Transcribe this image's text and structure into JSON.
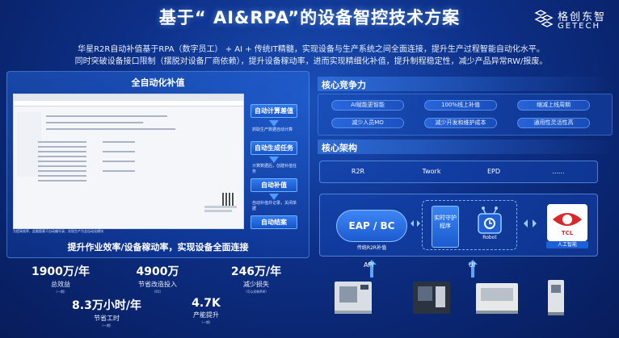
{
  "title": "基于“ AI&RPA”的设备智控技术方案",
  "logo": {
    "cn": "格创东智",
    "en": "GETECH",
    "icon": "getech-logo-icon",
    "accent": "#ffffff"
  },
  "intro": {
    "line1": "华星R2R自动补值基于RPA（数字员工） + AI + 传统IT精髓，实现设备与生产系统之间全面连接，提升生产过程智能自动化水平。",
    "line2": "同时突破设备接口限制（摆脱对设备厂商依赖），提升设备稼动率，进而实现精细化补值，提升制程稳定性，减少产品异常RW/报废。"
  },
  "left_panel": {
    "title": "全自动化补值",
    "screen_caption": "为提高效率，此截图基于自动编号录，实现生产为全自动化模块",
    "steps": [
      {
        "label": "自动计算差值",
        "note": ""
      },
      {
        "label": "自动生成任务",
        "note": "抓取生产数据自动计算"
      },
      {
        "label": "自动补值",
        "note": "计算数据后，创建补值任务"
      },
      {
        "label": "自动结案",
        "note": "自动补值并记录，关闭单据"
      }
    ],
    "bottom_title": "提升作业效率/设备稼动率，实现设备全面连接",
    "stats": [
      {
        "value": "1900万/年",
        "label": "总效益",
        "note": "（一期）"
      },
      {
        "value": "4900万",
        "label": "节省改造投入",
        "note": "（R2）"
      },
      {
        "value": "246万/年",
        "label": "减少损失",
        "note": "（可以抑制RW）"
      },
      {
        "value": "8.3万小时/年",
        "label": "节省工时",
        "note": "（一期）"
      },
      {
        "value": "4.7K",
        "label": "产能提升",
        "note": "（一期）"
      }
    ]
  },
  "core_competence": {
    "title": "核心竞争力",
    "items": [
      "AI赋能更智能",
      "100%线上补值",
      "缩减上线周期",
      "减少人员MO",
      "减少开发和维护成本",
      "通用性灵活性高"
    ]
  },
  "core_architecture": {
    "title": "核心架构",
    "systems": [
      "R2R",
      "Twork",
      "EPD",
      "......"
    ],
    "eap_label": "EAP / BC",
    "eap_caption": "传统R2R补值",
    "service_label": "实时守护程序",
    "robot_label": "Robot",
    "ai_label": "人工智能",
    "tcl_text": "TCL",
    "api_label": "API",
    "ui_label": "UI"
  },
  "colors": {
    "bg_center": "#1a4fb8",
    "bg_edge": "#071c5a",
    "button": "#2f7af0",
    "accent_line": "#6fb0ff",
    "tcl_red": "#d8282c"
  }
}
